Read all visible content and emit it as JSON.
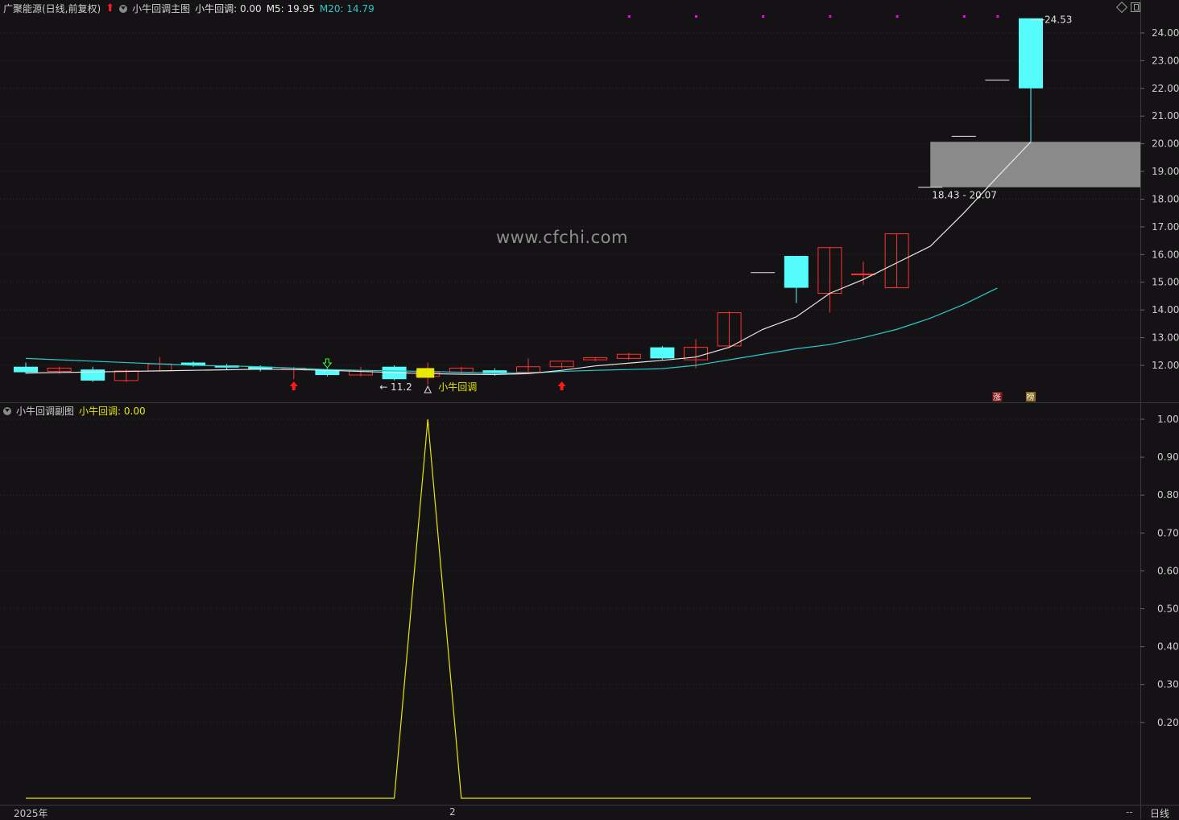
{
  "header": {
    "stock_title": "广聚能源(日线,前复权)",
    "indicator_name": "小牛回调主图",
    "indicator_value": "小牛回调: 0.00",
    "m5": "M5: 19.95",
    "m20": "M20: 14.79"
  },
  "subchart": {
    "title": "小牛回调副图",
    "value": "小牛回调: 0.00"
  },
  "watermark": "www.cfchi.com",
  "footer": {
    "year_label": "2025年",
    "month_label": "2",
    "dashes": "--",
    "period": "日线"
  },
  "colors": {
    "up": "#ff3333",
    "down": "#54fcfc",
    "ma5": "#e8e8e8",
    "ma20": "#2ec8c8",
    "yellow": "#e8e800",
    "magenta": "#ff00ff",
    "gray_zone": "#8a8a8a"
  },
  "chart_data": [
    {
      "type": "candlestick",
      "title": "小牛回调主图",
      "ylim": [
        11.2,
        24.7
      ],
      "yticks": [
        "24.00",
        "23.00",
        "22.00",
        "21.00",
        "20.00",
        "19.00",
        "18.00",
        "17.00",
        "16.00",
        "15.00",
        "14.00",
        "13.00",
        "12.00"
      ],
      "candles": [
        {
          "o": 11.95,
          "h": 12.1,
          "l": 11.7,
          "c": 11.75
        },
        {
          "o": 11.78,
          "h": 11.95,
          "l": 11.7,
          "c": 11.9
        },
        {
          "o": 11.85,
          "h": 11.95,
          "l": 11.4,
          "c": 11.45
        },
        {
          "o": 11.45,
          "h": 11.85,
          "l": 11.4,
          "c": 11.8
        },
        {
          "o": 11.8,
          "h": 12.3,
          "l": 11.78,
          "c": 12.05
        },
        {
          "o": 12.1,
          "h": 12.15,
          "l": 11.95,
          "c": 12.0
        },
        {
          "o": 12.0,
          "h": 12.05,
          "l": 11.85,
          "c": 11.92
        },
        {
          "o": 11.95,
          "h": 12.0,
          "l": 11.78,
          "c": 11.85
        },
        {
          "o": 11.85,
          "h": 11.95,
          "l": 11.5,
          "c": 11.9
        },
        {
          "o": 11.85,
          "h": 11.9,
          "l": 11.6,
          "c": 11.65
        },
        {
          "o": 11.65,
          "h": 11.95,
          "l": 11.6,
          "c": 11.8
        },
        {
          "o": 11.95,
          "h": 12.0,
          "l": 11.45,
          "c": 11.5
        },
        {
          "o": 11.6,
          "h": 12.1,
          "l": 11.3,
          "c": 11.75
        },
        {
          "o": 11.75,
          "h": 11.95,
          "l": 11.7,
          "c": 11.9
        },
        {
          "o": 11.82,
          "h": 11.9,
          "l": 11.62,
          "c": 11.7
        },
        {
          "o": 11.75,
          "h": 12.25,
          "l": 11.72,
          "c": 11.95
        },
        {
          "o": 11.95,
          "h": 12.1,
          "l": 11.9,
          "c": 12.15
        },
        {
          "o": 12.2,
          "h": 12.3,
          "l": 12.15,
          "c": 12.28
        },
        {
          "o": 12.25,
          "h": 12.45,
          "l": 12.2,
          "c": 12.4
        },
        {
          "o": 12.65,
          "h": 12.7,
          "l": 12.2,
          "c": 12.25
        },
        {
          "o": 12.2,
          "h": 12.95,
          "l": 11.9,
          "c": 12.65
        },
        {
          "o": 12.7,
          "h": 13.95,
          "l": 12.65,
          "c": 13.9
        },
        {
          "o": 15.35,
          "h": 15.35,
          "l": 15.35,
          "c": 15.35
        },
        {
          "o": 15.95,
          "h": 15.95,
          "l": 14.25,
          "c": 14.8
        },
        {
          "o": 14.6,
          "h": 16.25,
          "l": 13.9,
          "c": 16.25
        },
        {
          "o": 15.3,
          "h": 15.75,
          "l": 14.9,
          "c": 15.3
        },
        {
          "o": 14.8,
          "h": 16.75,
          "l": 14.8,
          "c": 16.75
        },
        {
          "o": 18.43,
          "h": 18.43,
          "l": 18.43,
          "c": 18.43
        },
        {
          "o": 20.27,
          "h": 20.27,
          "l": 20.27,
          "c": 20.27
        },
        {
          "o": 22.3,
          "h": 22.3,
          "l": 22.3,
          "c": 22.3
        },
        {
          "o": 24.53,
          "h": 24.53,
          "l": 20.07,
          "c": 22.0
        }
      ],
      "ma5": [
        11.72,
        11.74,
        11.76,
        11.78,
        11.8,
        11.82,
        11.84,
        11.86,
        11.85,
        11.82,
        11.78,
        11.74,
        11.7,
        11.68,
        11.67,
        11.7,
        11.82,
        11.98,
        12.08,
        12.18,
        12.3,
        12.65,
        13.3,
        13.75,
        14.6,
        15.1,
        15.7,
        16.3,
        17.5,
        18.8,
        20.07
      ],
      "ma20": [
        12.25,
        12.2,
        12.15,
        12.1,
        12.05,
        12.0,
        11.98,
        11.95,
        11.9,
        11.85,
        11.82,
        11.8,
        11.78,
        11.75,
        11.72,
        11.72,
        11.78,
        11.82,
        11.85,
        11.88,
        12.0,
        12.2,
        12.4,
        12.6,
        12.75,
        13.0,
        13.3,
        13.7,
        14.2,
        14.79
      ],
      "annotations": {
        "high_label": "24.53",
        "low_label": "11.2",
        "signal_label": "小牛回调",
        "zone_label": "18.43 - 20.07",
        "zone": [
          18.43,
          20.07
        ],
        "badge_zhang": "涨",
        "badge_bang": "榜"
      }
    },
    {
      "type": "line",
      "title": "小牛回调副图",
      "ylim": [
        0.0,
        1.04
      ],
      "yticks": [
        "1.00",
        "0.90",
        "0.80",
        "0.70",
        "0.60",
        "0.50",
        "0.40",
        "0.30",
        "0.20"
      ],
      "values": [
        0,
        0,
        0,
        0,
        0,
        0,
        0,
        0,
        0,
        0,
        0,
        0,
        1,
        0,
        0,
        0,
        0,
        0,
        0,
        0,
        0,
        0,
        0,
        0,
        0,
        0,
        0,
        0,
        0,
        0,
        0
      ]
    }
  ]
}
